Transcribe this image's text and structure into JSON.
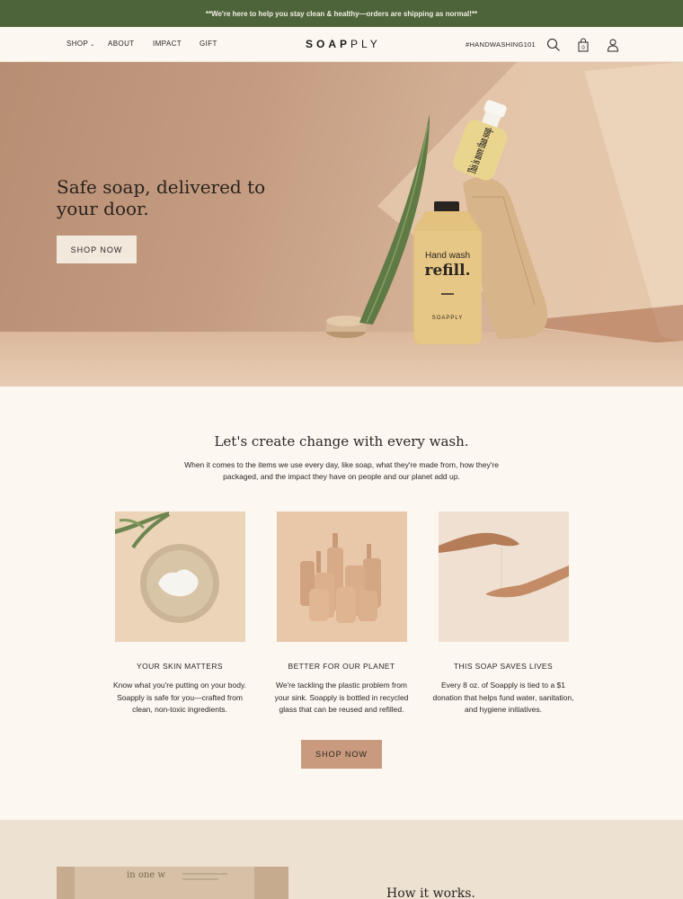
{
  "announcement": "**We're here to help you stay clean & healthy—orders are shipping as normal!**",
  "nav": {
    "shop": "SHOP",
    "about": "ABOUT",
    "impact": "IMPACT",
    "gift": "GIFT"
  },
  "logo": {
    "bold": "SOAP",
    "light": "PLY"
  },
  "hashtag": "#HANDWASHING101",
  "cart_count": "0",
  "hero": {
    "title": "Safe soap, delivered to your door.",
    "button": "SHOP NOW",
    "bottle_top": "This is more than soap.",
    "bottle_main_line1": "Hand wash",
    "bottle_main_line2": "refill.",
    "bottle_brand": "SOAPPLY"
  },
  "mission": {
    "title": "Let's create change with every wash.",
    "text": "When it comes to the items we use every day, like soap, what they're made from, how they're packaged, and the impact they have on people and our planet add up."
  },
  "features": [
    {
      "title": "YOUR SKIN MATTERS",
      "text": "Know what you're putting on your body. Soapply is safe for you—crafted from clean, non-toxic ingredients."
    },
    {
      "title": "BETTER FOR OUR PLANET",
      "text": "We're tackling the plastic problem from your sink. Soapply is bottled in recycled glass that can be reused and refilled."
    },
    {
      "title": "THIS SOAP SAVES LIVES",
      "text": "Every 8 oz. of Soapply is tied to a $1 donation that helps fund water, sanitation, and hygiene initiatives."
    }
  ],
  "cta": "SHOP NOW",
  "how": {
    "title": "How it works.",
    "box_text": "in one w"
  },
  "colors": {
    "announcement_bg": "#4d6339",
    "page_bg": "#fcf7f0",
    "cta_bg": "#c99a7d",
    "how_bg": "#ede1d2"
  }
}
